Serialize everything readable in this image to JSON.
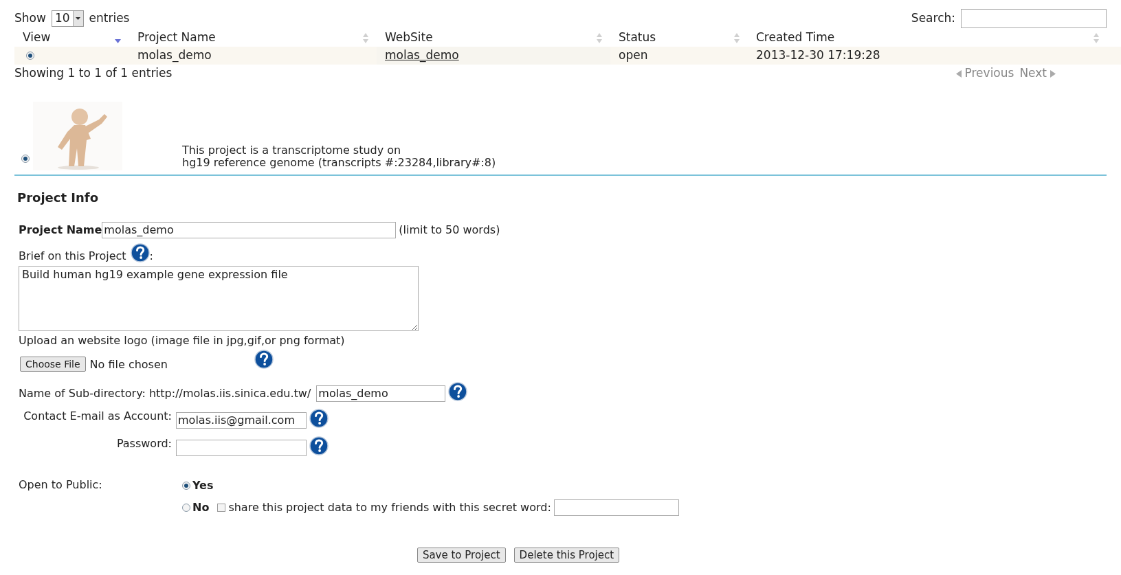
{
  "length_control": {
    "prefix": "Show",
    "value": "10",
    "suffix": "entries"
  },
  "search": {
    "label": "Search:"
  },
  "table": {
    "columns": [
      {
        "label": "View",
        "sorted": true
      },
      {
        "label": "Project Name",
        "sorted": false
      },
      {
        "label": "WebSite",
        "sorted": false
      },
      {
        "label": "Status",
        "sorted": false
      },
      {
        "label": "Created Time",
        "sorted": false
      }
    ],
    "rows": [
      {
        "selected": true,
        "cells": [
          {
            "kind": "radio"
          },
          {
            "kind": "text",
            "text": "molas_demo"
          },
          {
            "kind": "link",
            "text": "molas_demo"
          },
          {
            "kind": "text",
            "text": "open"
          },
          {
            "kind": "text",
            "text": "2013-12-30 17:19:28"
          }
        ]
      }
    ]
  },
  "table_info": "Showing 1 to 1 of 1 entries",
  "pager": [
    {
      "label": "Previous",
      "kind": "prev",
      "disabled": true
    },
    {
      "label": "Next",
      "kind": "next",
      "disabled": true
    }
  ],
  "project_card": {
    "selected": true,
    "description": [
      "This project is a transcriptome study on",
      "hg19 reference genome (transcripts #:23284,library#:8)"
    ]
  },
  "form": {
    "title": "Project Info",
    "project_name": {
      "label": "Project Name",
      "value": "molas_demo",
      "note": "(limit to 50 words)"
    },
    "brief": {
      "label": "Brief on this Project",
      "suffix": ":",
      "value": "Build human hg19 example gene expression file"
    },
    "logo": {
      "label": "Upload an website logo (image file in jpg,gif,or png format)",
      "button": "Choose File",
      "status": "No file chosen"
    },
    "subdirectory": {
      "label": "Name of Sub-directory: http://molas.iis.sinica.edu.tw/",
      "value": "molas_demo"
    },
    "email": {
      "label": "Contact E-mail as Account:",
      "value": "molas.iis@gmail.com"
    },
    "password": {
      "label": "Password:"
    },
    "open_to_public": {
      "label": "Open to Public:",
      "options": [
        {
          "label": "Yes",
          "selected": true
        },
        {
          "label": "No",
          "selected": false
        }
      ]
    },
    "share": {
      "checked": false,
      "label": "share this project data to my friends with this secret word:"
    },
    "buttons": [
      "Save to Project",
      "Delete this Project"
    ]
  }
}
